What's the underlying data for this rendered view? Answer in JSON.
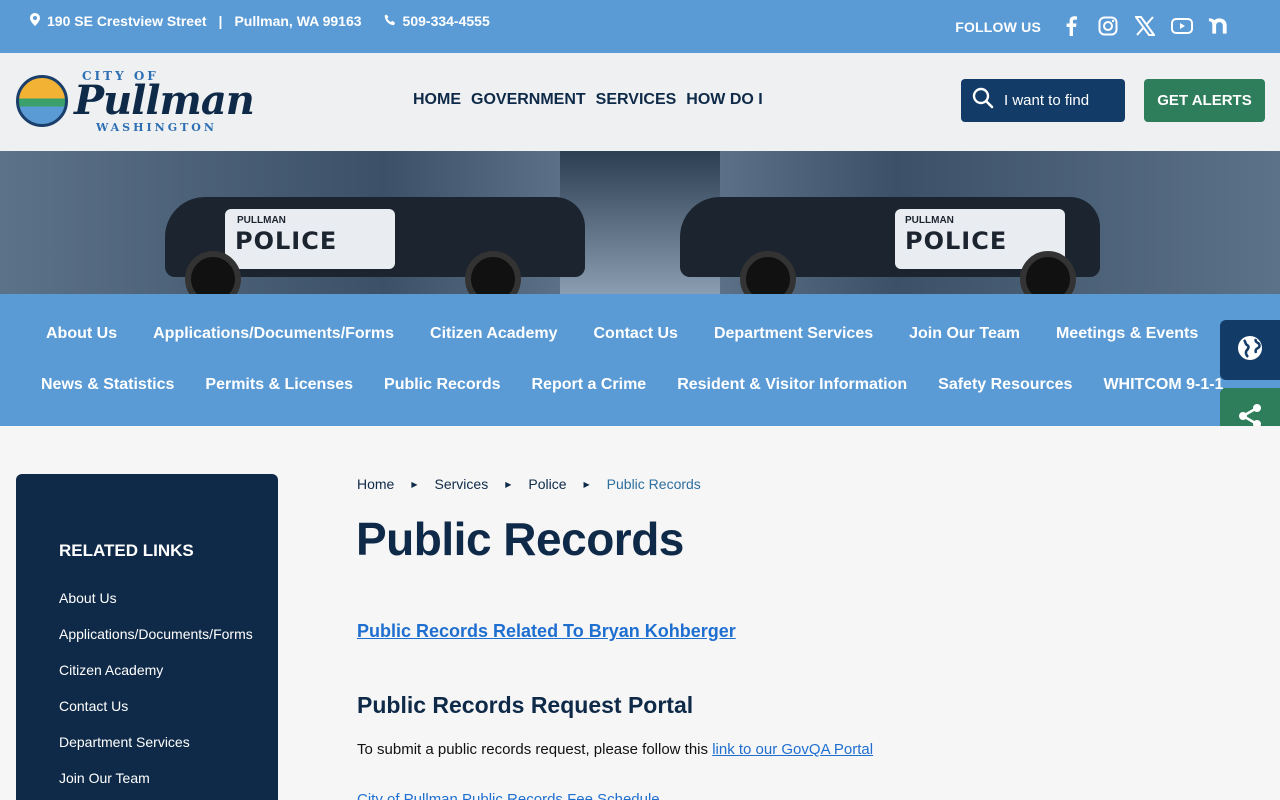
{
  "topbar": {
    "address": "190 SE Crestview Street",
    "separator": "|",
    "city": "Pullman, WA 99163",
    "phone": "509-334-4555",
    "follow_label": "FOLLOW US",
    "social_icons": [
      "facebook-icon",
      "instagram-icon",
      "x-icon",
      "youtube-icon",
      "nextdoor-icon"
    ]
  },
  "logo": {
    "city_of": "CITY OF",
    "name": "Pullman",
    "state": "WASHINGTON"
  },
  "main_nav": [
    "HOME",
    "GOVERNMENT",
    "SERVICES",
    "HOW DO I"
  ],
  "search": {
    "placeholder": "I want to find"
  },
  "alerts_label": "GET ALERTS",
  "banner": {
    "car_brand": "PULLMAN",
    "car_text": "POLICE"
  },
  "sub_nav": {
    "row1": [
      "About Us",
      "Applications/Documents/Forms",
      "Citizen Academy",
      "Contact Us",
      "Department Services",
      "Join Our Team",
      "Meetings & Events"
    ],
    "row2": [
      "News & Statistics",
      "Permits & Licenses",
      "Public Records",
      "Report a Crime",
      "Resident & Visitor Information",
      "Safety Resources",
      "WHITCOM 9-1-1"
    ]
  },
  "related_links": {
    "heading": "RELATED LINKS",
    "items": [
      "About Us",
      "Applications/Documents/Forms",
      "Citizen Academy",
      "Contact Us",
      "Department Services",
      "Join Our Team"
    ]
  },
  "breadcrumb": [
    "Home",
    "Services",
    "Police",
    "Public Records"
  ],
  "page": {
    "title": "Public Records",
    "kohberger_link": "Public Records Related To Bryan Kohberger",
    "portal_heading": "Public Records Request Portal",
    "portal_text": "To submit a public records request, please follow this ",
    "portal_link": "link to our GovQA Portal",
    "fee_link": "City of Pullman Public Records Fee Schedule"
  },
  "colors": {
    "topbar": "#5b9bd5",
    "navy": "#0f2a48",
    "alerts_green": "#2e7d5b",
    "link_blue": "#1f6fd1"
  }
}
